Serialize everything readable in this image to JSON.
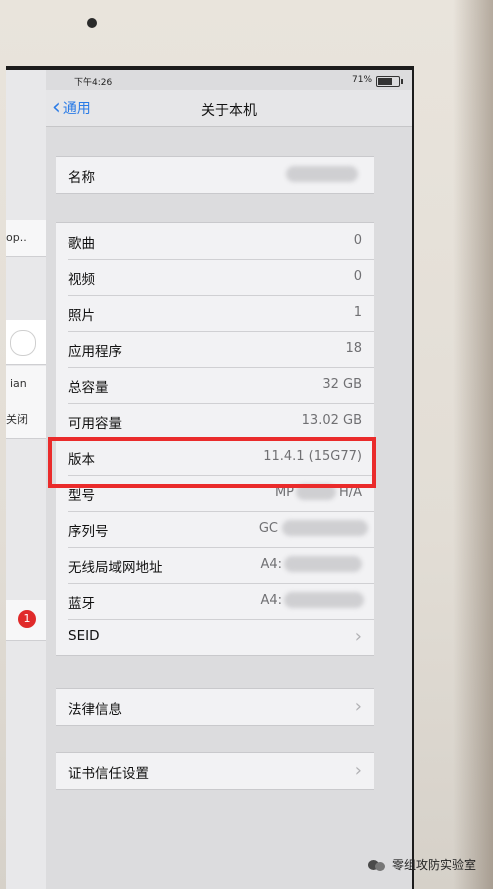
{
  "status_bar": {
    "time": "下午4:26",
    "battery": "71%"
  },
  "nav": {
    "back_label": "通用",
    "title": "关于本机"
  },
  "master_pane": {
    "rows": [
      "op..",
      "ian",
      "关闭"
    ],
    "badge_count": "1"
  },
  "name_group": {
    "label": "名称"
  },
  "info_group": [
    {
      "label": "歌曲",
      "value": "0"
    },
    {
      "label": "视频",
      "value": "0"
    },
    {
      "label": "照片",
      "value": "1"
    },
    {
      "label": "应用程序",
      "value": "18"
    },
    {
      "label": "总容量",
      "value": "32 GB"
    },
    {
      "label": "可用容量",
      "value": "13.02 GB"
    },
    {
      "label": "版本",
      "value": "11.4.1 (15G77)"
    },
    {
      "label": "型号",
      "value": "MP",
      "value_suffix": "H/A"
    },
    {
      "label": "序列号",
      "value": "GC"
    },
    {
      "label": "无线局域网地址",
      "value": "A4:"
    },
    {
      "label": "蓝牙",
      "value": "A4:"
    },
    {
      "label": "SEID"
    }
  ],
  "legal_group": {
    "label": "法律信息"
  },
  "cert_group": {
    "label": "证书信任设置"
  },
  "watermark": {
    "text": "零组攻防实验室"
  },
  "colors": {
    "ios_blue": "#2a7be6",
    "highlight_red": "#ea2b2b"
  }
}
